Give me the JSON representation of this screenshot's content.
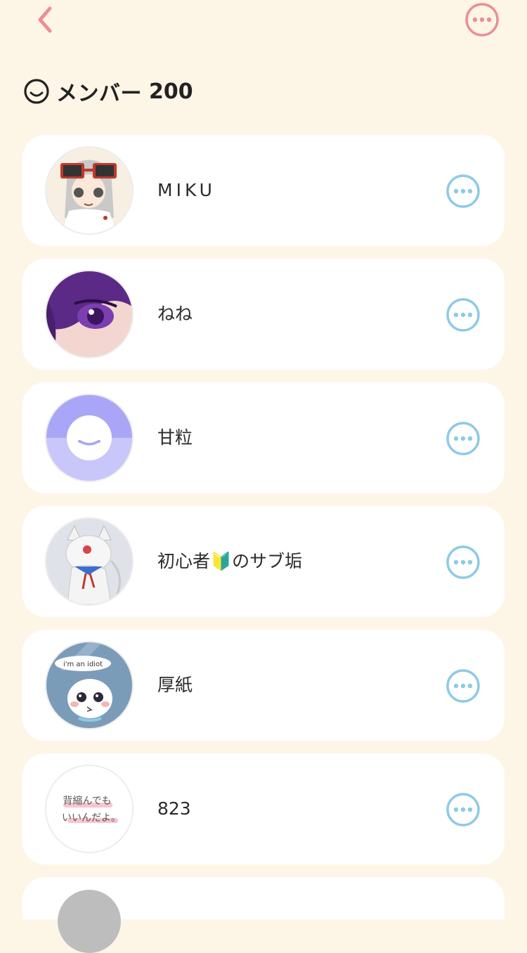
{
  "header": {
    "back_icon": "chevron-left-icon",
    "more_icon": "more-horizontal-circle-icon",
    "accent_color": "#ee8d94"
  },
  "section": {
    "icon": "smile-face-icon",
    "title": "メンバー",
    "count": "200"
  },
  "members": [
    {
      "name": "MIKU",
      "avatar": "avatar-miku"
    },
    {
      "name": "ねね",
      "avatar": "avatar-nene"
    },
    {
      "name": "甘粒",
      "avatar": "avatar-default-smile"
    },
    {
      "name": "初心者🔰のサブ垢",
      "avatar": "avatar-cat"
    },
    {
      "name": "厚紙",
      "avatar": "avatar-idiot"
    },
    {
      "name": "823",
      "avatar": "avatar-handwritten"
    }
  ],
  "avatar_texts": {
    "idiot_bubble": "i'm an idiot",
    "handwritten_line1": "背縮んでも",
    "handwritten_line2": "いいんだよ。"
  },
  "colors": {
    "background": "#fdf6e7",
    "card": "#ffffff",
    "member_more": "#8ecae6",
    "text": "#222222"
  }
}
